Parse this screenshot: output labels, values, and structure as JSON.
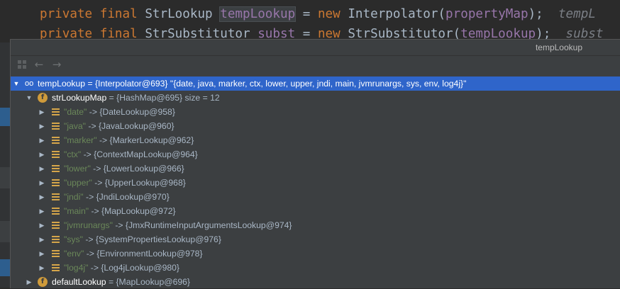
{
  "editor": {
    "line1": {
      "kw1": "private",
      "kw2": "final",
      "type": "StrLookup",
      "var": "tempLookup",
      "eq": "=",
      "kw3": "new",
      "ctor": "Interpolator(",
      "arg": "propertyMap",
      "tail": ");",
      "hint": "tempL"
    },
    "line2": {
      "kw1": "private",
      "kw2": "final",
      "type": "StrSubstitutor",
      "var": "subst",
      "eq": "=",
      "kw3": "new",
      "ctor": "StrSubstitutor(",
      "arg": "tempLookup",
      "tail": ");",
      "hint": "subst"
    }
  },
  "popup": {
    "title": "tempLookup",
    "back_arrow": "←",
    "forward_arrow": "→"
  },
  "tree": {
    "root": {
      "name": "tempLookup",
      "value": " = {Interpolator@693} \"{date, java, marker, ctx, lower, upper, jndi, main, jvmrunargs, sys, env, log4j}\""
    },
    "map": {
      "field_badge": "f",
      "name": "strLookupMap",
      "value": " = {HashMap@695}  size = 12"
    },
    "entries": [
      {
        "key": "\"date\"",
        "value": " -> {DateLookup@958}"
      },
      {
        "key": "\"java\"",
        "value": " -> {JavaLookup@960}"
      },
      {
        "key": "\"marker\"",
        "value": " -> {MarkerLookup@962}"
      },
      {
        "key": "\"ctx\"",
        "value": " -> {ContextMapLookup@964}"
      },
      {
        "key": "\"lower\"",
        "value": " -> {LowerLookup@966}"
      },
      {
        "key": "\"upper\"",
        "value": " -> {UpperLookup@968}"
      },
      {
        "key": "\"jndi\"",
        "value": " -> {JndiLookup@970}"
      },
      {
        "key": "\"main\"",
        "value": " -> {MapLookup@972}"
      },
      {
        "key": "\"jvmrunargs\"",
        "value": " -> {JmxRuntimeInputArgumentsLookup@974}"
      },
      {
        "key": "\"sys\"",
        "value": " -> {SystemPropertiesLookup@976}"
      },
      {
        "key": "\"env\"",
        "value": " -> {EnvironmentLookup@978}"
      },
      {
        "key": "\"log4j\"",
        "value": " -> {Log4jLookup@980}"
      }
    ],
    "default": {
      "field_badge": "f",
      "name": "defaultLookup",
      "value": " = {MapLookup@696}"
    }
  }
}
